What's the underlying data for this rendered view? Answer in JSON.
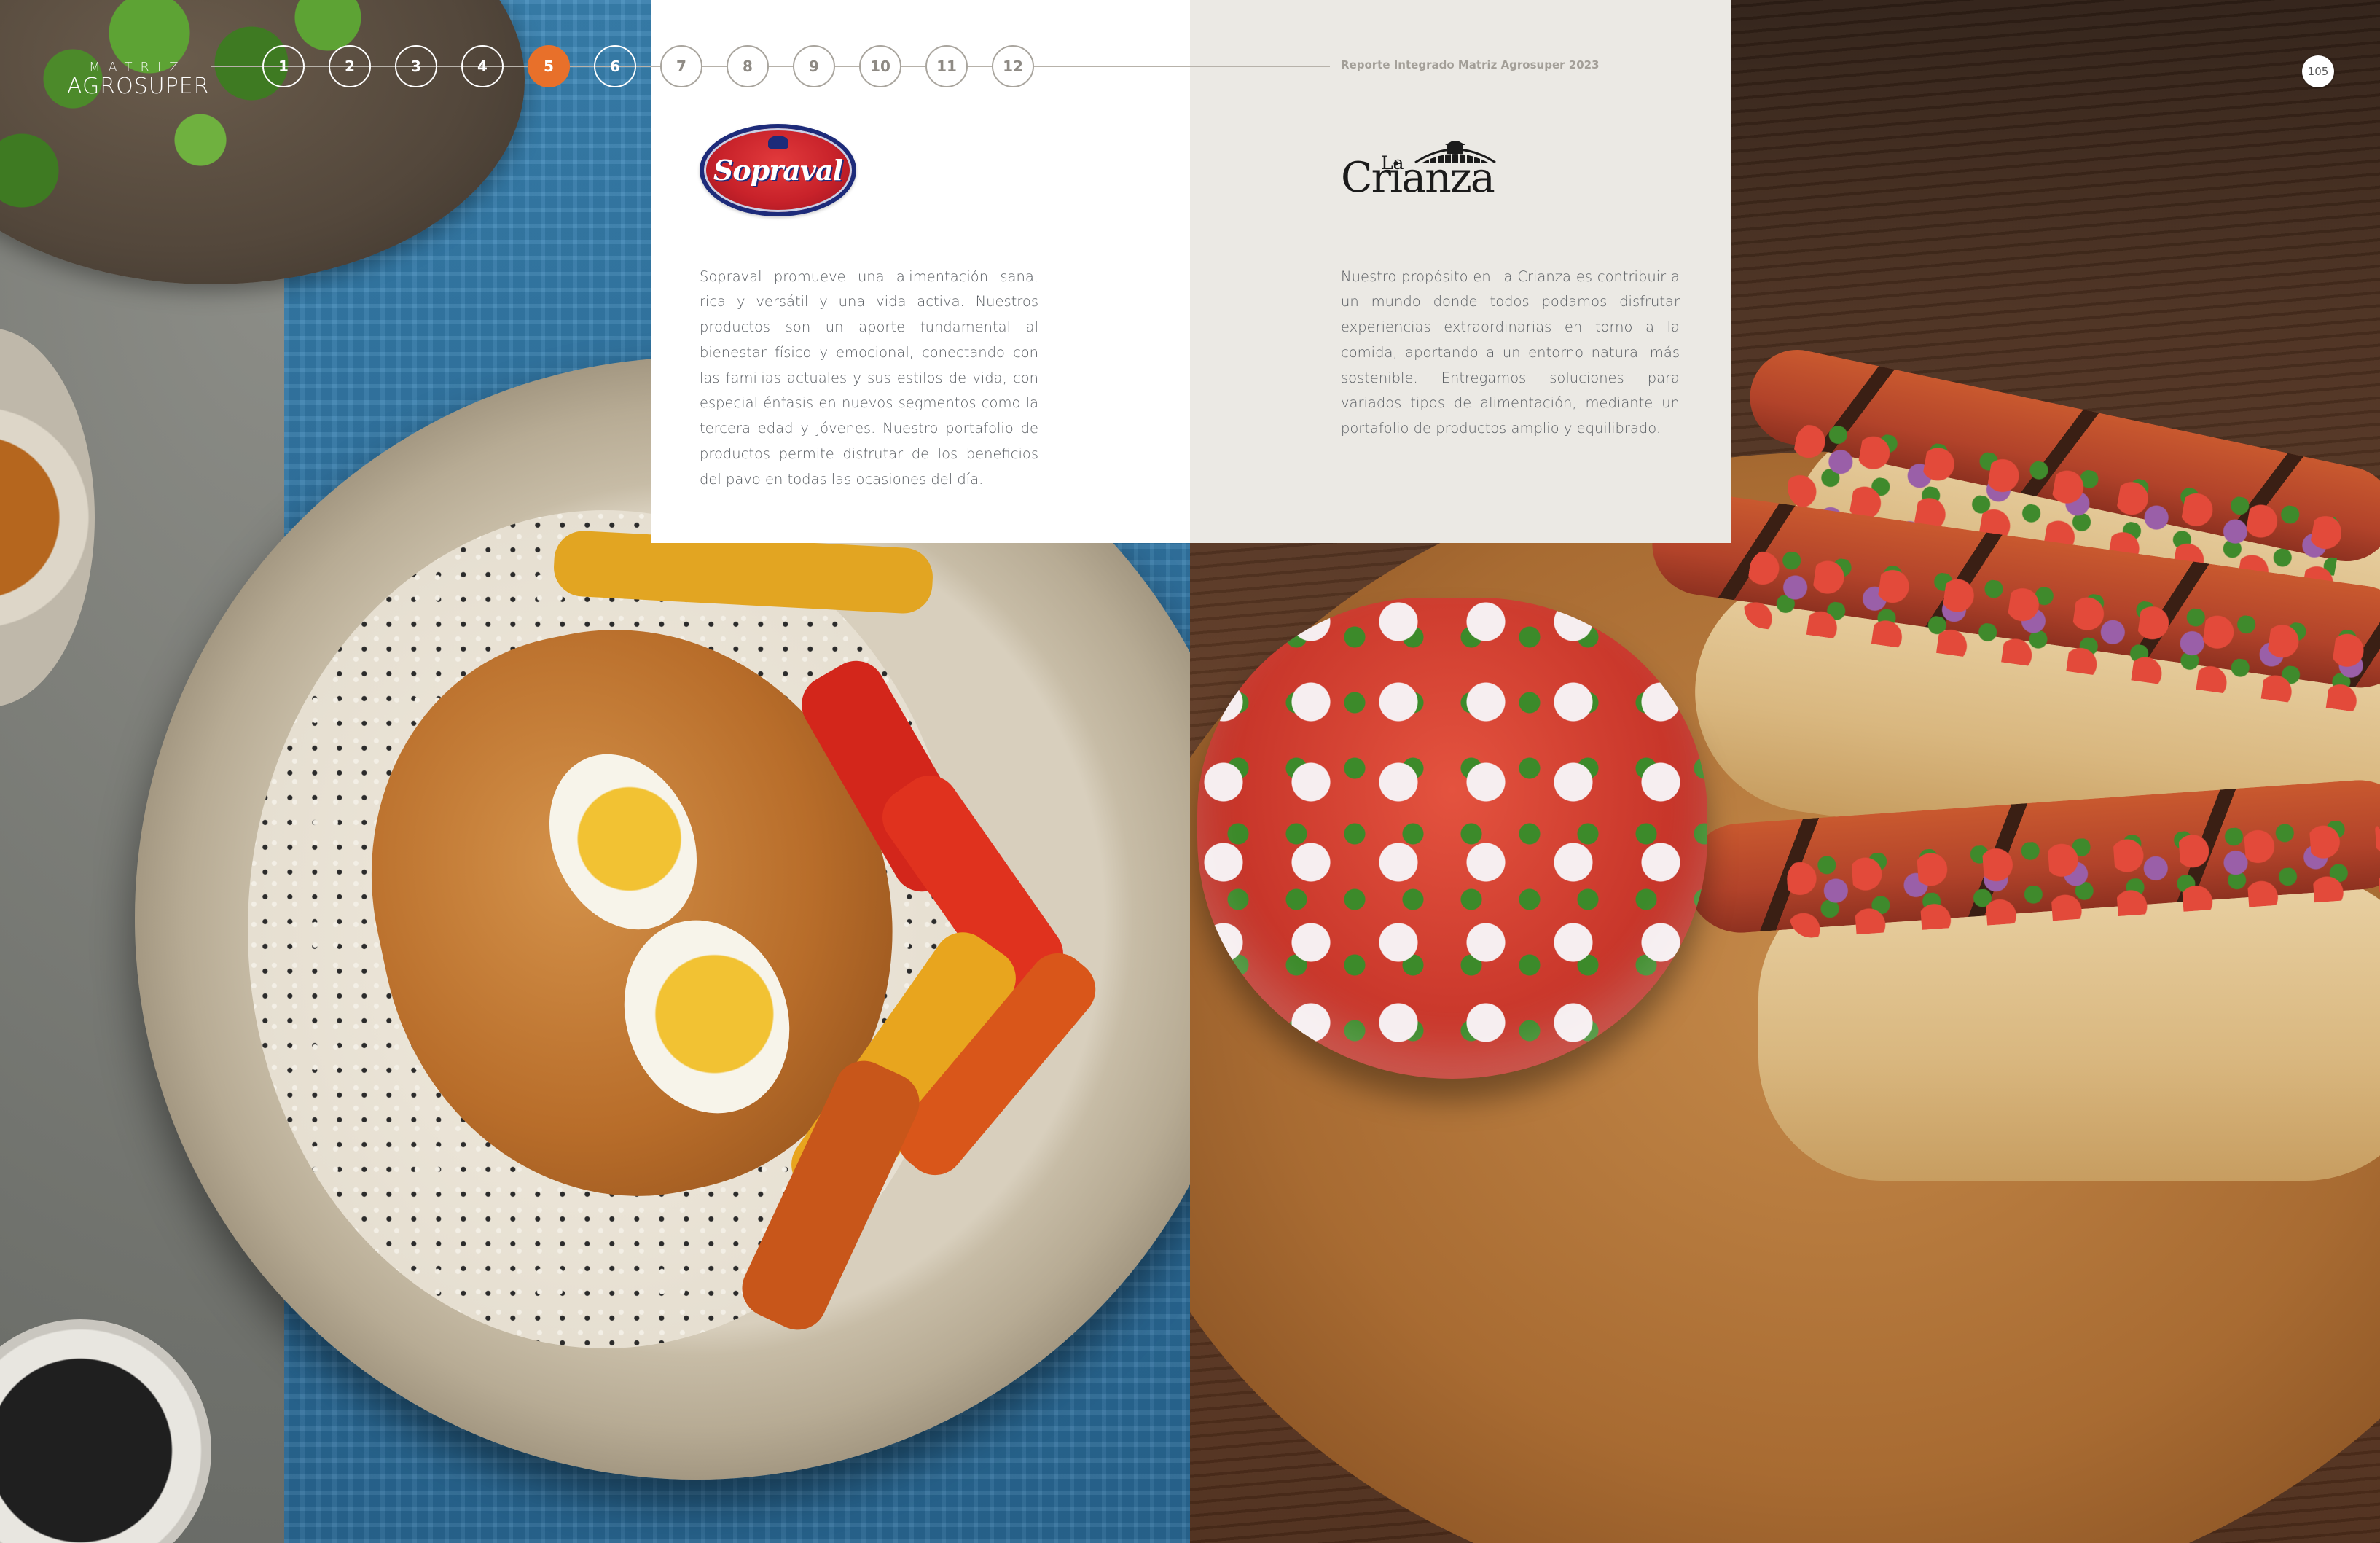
{
  "header": {
    "brand_small": "MATRIZ",
    "brand_big": "AGROSUPER",
    "report_title": "Reporte Integrado Matriz Agrosuper 2023",
    "page_number": "105"
  },
  "nav": {
    "items": [
      "1",
      "2",
      "3",
      "4",
      "5",
      "6",
      "7",
      "8",
      "9",
      "10",
      "11",
      "12"
    ],
    "active": "5"
  },
  "sopraval": {
    "logo_text": "Sopraval",
    "description": "Sopraval promueve una alimentación sana, rica y versátil y una vida activa. Nuestros productos son un aporte fundamental al bienestar físico y emocional, conectando con las familias actuales y sus estilos de vida, con especial énfasis en nuevos segmentos como la tercera edad y jóvenes. Nuestro portafolio de productos permite disfrutar de los beneficios del pavo en todas las ocasiones del día."
  },
  "la_crianza": {
    "logo_la": "La",
    "logo_word": "Crianza",
    "description": "Nuestro propósito en La Crianza es contribuir a un mundo donde todos podamos disfrutar experiencias extraordinarias en torno a la comida, aportando a un entorno natural más sostenible. Entregamos soluciones para variados tipos de alimentación, mediante un portafolio de productos amplio y equilibrado."
  },
  "colors": {
    "accent": "#e8702a",
    "sopraval_red": "#c8222a",
    "sopraval_blue": "#1d2b7a",
    "panel_right_bg": "#ebe9e4"
  }
}
